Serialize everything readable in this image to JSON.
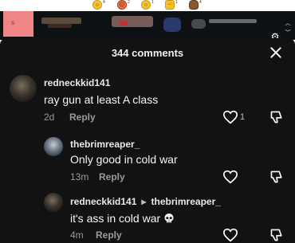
{
  "reactions": [
    {
      "icon": "grinning-face-icon",
      "count": "4"
    },
    {
      "icon": "angry-face-icon",
      "count": "2"
    },
    {
      "icon": "smiling-face-icon",
      "count": "1"
    },
    {
      "icon": "muscle-icon",
      "count": "1"
    },
    {
      "icon": "poop-icon",
      "count": "4"
    }
  ],
  "tier": {
    "label": "S"
  },
  "sheet": {
    "title": "344 comments"
  },
  "comments": [
    {
      "username": "redneckkid141",
      "text": "ray gun at least A class",
      "time": "2d",
      "reply_label": "Reply",
      "likes": "1"
    },
    {
      "username": "thebrimreaper_",
      "text": "Only good in cold war",
      "time": "13m",
      "reply_label": "Reply",
      "likes": ""
    },
    {
      "username": "redneckkid141",
      "reply_to": "thebrimreaper_",
      "text": "it's ass in cold war",
      "emoji": "skull-icon",
      "time": "4m",
      "reply_label": "Reply",
      "likes": ""
    }
  ]
}
